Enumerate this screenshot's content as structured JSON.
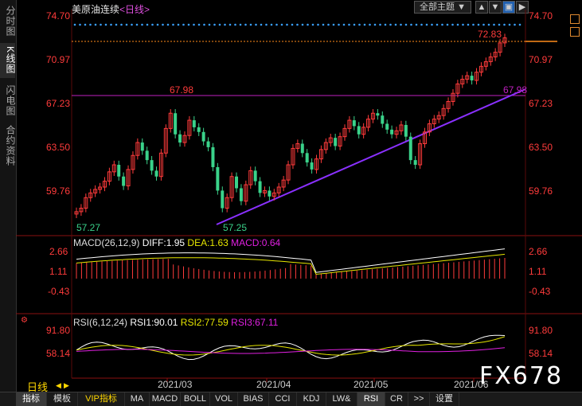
{
  "left_tabs": [
    {
      "label": "分时图",
      "active": false
    },
    {
      "label": "K线图",
      "active": true
    },
    {
      "label": "闪电图",
      "active": false
    },
    {
      "label": "合约资料",
      "active": false
    }
  ],
  "header": {
    "instrument": "美原油连续",
    "period": "<日线>",
    "theme_label": "全部主题",
    "theme_arrow": "▼"
  },
  "price_axis": {
    "labels": [
      "74.70",
      "70.97",
      "67.23",
      "63.50",
      "59.76"
    ]
  },
  "macd_axis": {
    "labels": [
      "2.66",
      "1.11",
      "-0.43"
    ]
  },
  "rsi_axis": {
    "labels": [
      "91.80",
      "58.14"
    ]
  },
  "annotations": {
    "last_price": "72.83",
    "high": "67.98",
    "high_right": "67.98",
    "low_left": "57.27",
    "low_mid": "57.25"
  },
  "macd": {
    "name": "MACD(26,12,9)",
    "diff": "DIFF:1.95",
    "dea": "DEA:1.63",
    "macd": "MACD:0.64"
  },
  "rsi": {
    "name": "RSI(6,12,24)",
    "rsi1": "RSI1:90.01",
    "rsi2": "RSI2:77.59",
    "rsi3": "RSI3:67.11"
  },
  "period_label": "日线",
  "dates": [
    "2021/03",
    "2021/04",
    "2021/05",
    "2021/06"
  ],
  "bottom_tabs": [
    "指标",
    "模板",
    "VIP指标",
    "MA",
    "MACD",
    "BOLL",
    "VOL",
    "BIAS",
    "CCI",
    "KDJ",
    "LW&",
    "RSI",
    "CR",
    ">>",
    "设置"
  ],
  "watermark": "FX678",
  "colors": {
    "up": "#ff3b3b",
    "down": "#3ad28a",
    "resist": "#c020c0",
    "trend": "#8a30ff",
    "diff": "#ffffff",
    "dea": "#e6e600",
    "rsi3": "#e020e0"
  }
}
